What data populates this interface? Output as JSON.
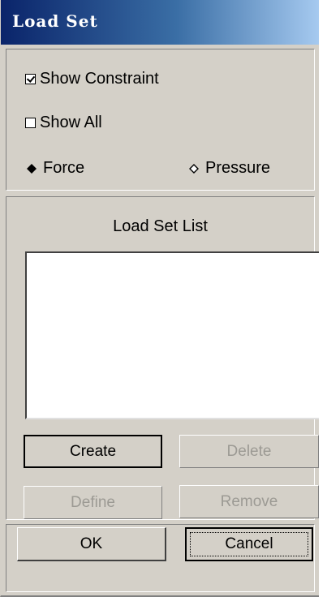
{
  "window": {
    "title": "Load Set"
  },
  "options": {
    "show_constraint": {
      "label": "Show Constraint",
      "checked": true
    },
    "show_all": {
      "label": "Show All",
      "checked": false
    },
    "load_type": {
      "options": [
        "Force",
        "Pressure"
      ],
      "selected": "Force"
    }
  },
  "list": {
    "title": "Load Set List",
    "items": []
  },
  "buttons": {
    "create": "Create",
    "delete": "Delete",
    "define": "Define",
    "remove": "Remove",
    "ok": "OK",
    "cancel": "Cancel"
  }
}
